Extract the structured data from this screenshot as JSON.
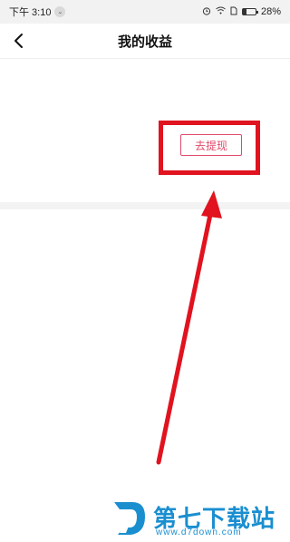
{
  "status_bar": {
    "time": "下午 3:10",
    "battery_percent": "28%",
    "icons": [
      "alarm-icon",
      "wifi-icon",
      "sim-icon",
      "battery-icon"
    ]
  },
  "header": {
    "title": "我的收益",
    "back_icon": "chevron-left-icon"
  },
  "main": {
    "withdraw_label": "去提现"
  },
  "watermark": {
    "logo_text": "第七下载站",
    "url": "www.d7down.com"
  },
  "colors": {
    "accent": "#e04a6a",
    "annotation": "#e0131f",
    "watermark": "#1a8fd0"
  }
}
